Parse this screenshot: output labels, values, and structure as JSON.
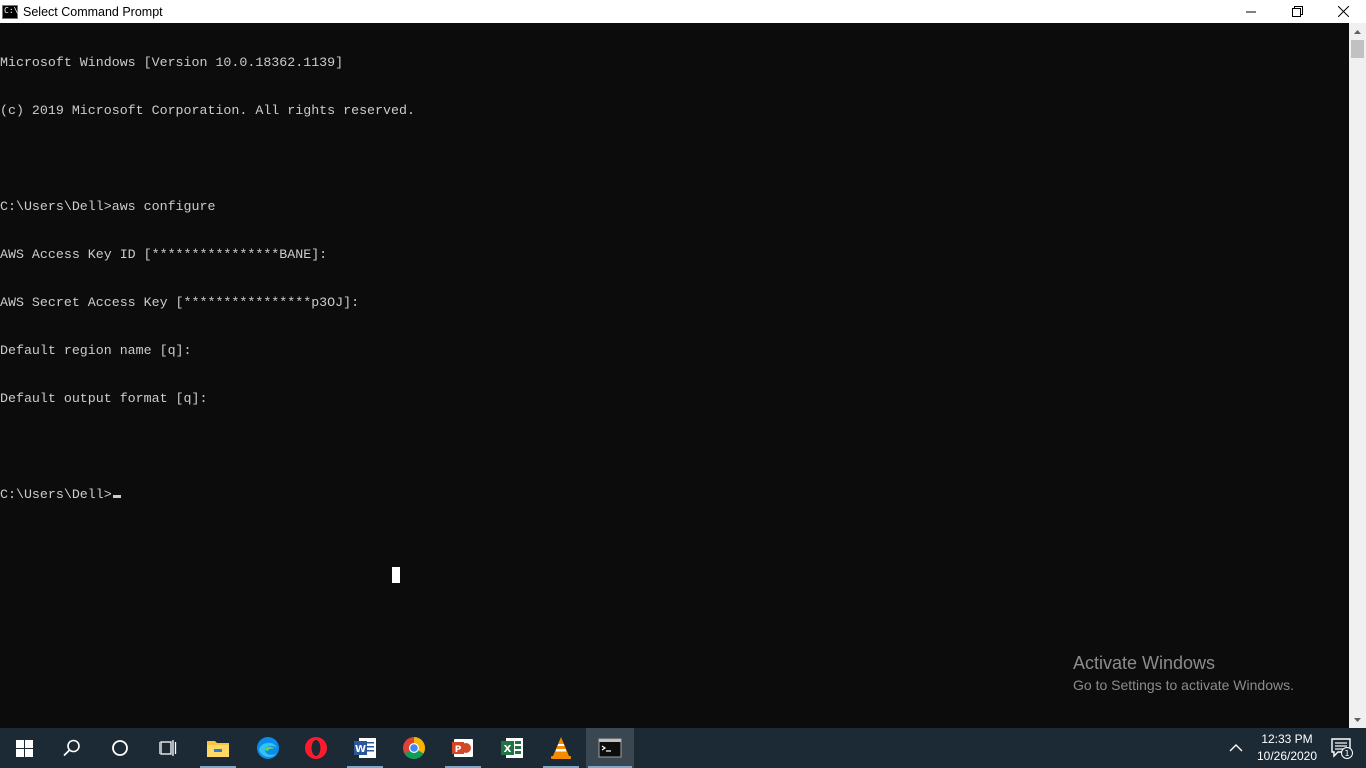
{
  "window": {
    "title": "Select Command Prompt",
    "icon_text": "C:\\",
    "controls": [
      "minimize-icon",
      "restore-icon",
      "close-icon"
    ]
  },
  "console": {
    "lines": [
      "Microsoft Windows [Version 10.0.18362.1139]",
      "(c) 2019 Microsoft Corporation. All rights reserved.",
      "",
      "C:\\Users\\Dell>aws configure",
      "AWS Access Key ID [****************BANE]:",
      "AWS Secret Access Key [****************p3OJ]:",
      "Default region name [q]:",
      "Default output format [q]:",
      "",
      "C:\\Users\\Dell>"
    ],
    "text_color": "#cccccc",
    "background": "#0c0c0c"
  },
  "watermark": {
    "title": "Activate Windows",
    "subtitle": "Go to Settings to activate Windows."
  },
  "taskbar": {
    "background": "#1b2a35",
    "items": [
      {
        "name": "start-icon"
      },
      {
        "name": "search-icon"
      },
      {
        "name": "cortana-icon"
      },
      {
        "name": "task-view-icon"
      },
      {
        "name": "file-explorer-icon"
      },
      {
        "name": "edge-icon"
      },
      {
        "name": "opera-icon"
      },
      {
        "name": "word-icon"
      },
      {
        "name": "chrome-icon"
      },
      {
        "name": "powerpoint-icon"
      },
      {
        "name": "excel-icon"
      },
      {
        "name": "vlc-icon"
      },
      {
        "name": "command-prompt-icon"
      }
    ],
    "clock": {
      "time": "12:33 PM",
      "date": "10/26/2020"
    },
    "notification_count": "1"
  }
}
